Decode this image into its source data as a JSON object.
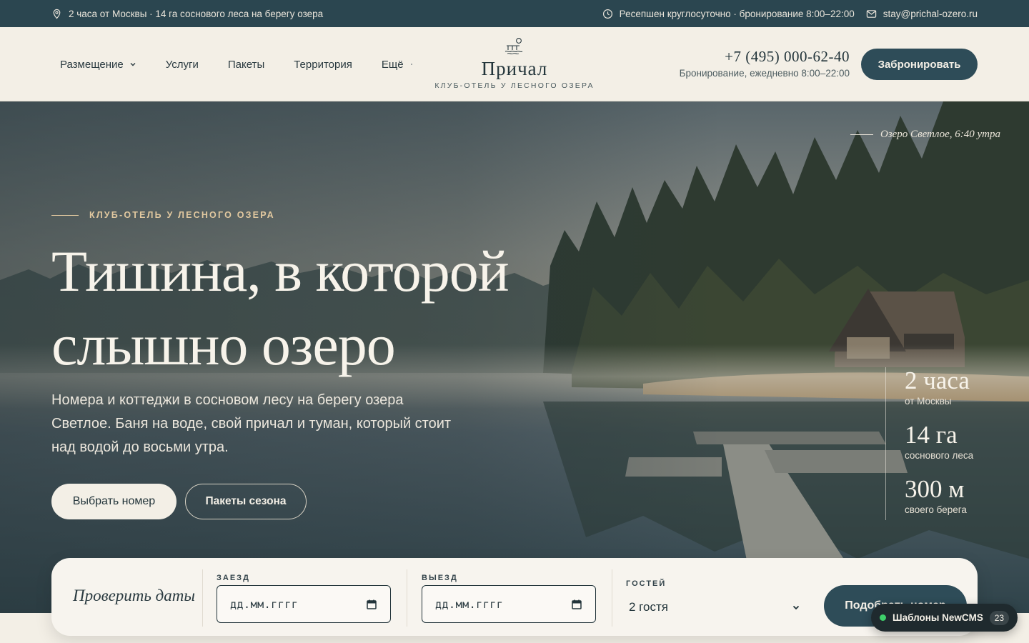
{
  "topbar": {
    "location": "2 часа от Москвы · 14 га соснового леса на берегу озера",
    "reception": "Ресепшен круглосуточно · бронирование 8:00–22:00",
    "email": "stay@prichal-ozero.ru"
  },
  "nav": {
    "items": [
      "Размещение",
      "Услуги",
      "Пакеты",
      "Территория",
      "Ещё"
    ]
  },
  "logo": {
    "title": "Причал",
    "subtitle": "КЛУБ-ОТЕЛЬ У ЛЕСНОГО ОЗЕРА"
  },
  "contact": {
    "phone": "+7 (495) 000-62-40",
    "hours": "Бронирование, ежедневно 8:00–22:00",
    "book_label": "Забронировать"
  },
  "hero": {
    "caption": "Озеро Светлое, 6:40 утра",
    "eyebrow": "КЛУБ-ОТЕЛЬ У ЛЕСНОГО ОЗЕРА",
    "title_line1": "Тишина, в которой",
    "title_line2": "слышно озеро",
    "lead": "Номера и коттеджи в сосновом лесу на берегу озера Светлое. Баня на воде, свой причал и туман, который стоит над водой до восьми утра.",
    "primary_label": "Выбрать номер",
    "secondary_label": "Пакеты сезона",
    "stats": [
      {
        "value": "2 часа",
        "label": "от Москвы"
      },
      {
        "value": "14 га",
        "label": "соснового леса"
      },
      {
        "value": "300 м",
        "label": "своего берега"
      }
    ]
  },
  "booking": {
    "title": "Проверить даты",
    "checkin_label": "ЗАЕЗД",
    "checkin_placeholder": "дд.мм.гггг",
    "checkout_label": "ВЫЕЗД",
    "checkout_placeholder": "дд.мм.гггг",
    "guests_label": "ГОСТЕЙ",
    "guests_value": "2 гостя",
    "search_label": "Подобрать номер"
  },
  "widget": {
    "label": "Шаблоны NewCMS",
    "count": "23"
  },
  "colors": {
    "dark_teal": "#2b4650",
    "button_teal": "#2e4c58",
    "cream": "#f3efe6",
    "accent_gold": "#e2c9a0"
  }
}
